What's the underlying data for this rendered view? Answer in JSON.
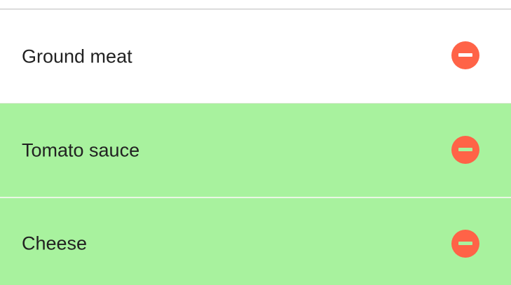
{
  "colors": {
    "row_default_bg": "#ffffff",
    "row_highlight_bg": "#a8f29e",
    "remove_button": "#ff6347",
    "divider": "#dcdcdc"
  },
  "items": [
    {
      "label": "Ground meat",
      "highlighted": false,
      "remove_icon": "minus-circle-icon"
    },
    {
      "label": "Tomato sauce",
      "highlighted": true,
      "remove_icon": "minus-circle-icon"
    },
    {
      "label": "Cheese",
      "highlighted": true,
      "remove_icon": "minus-circle-icon"
    }
  ]
}
